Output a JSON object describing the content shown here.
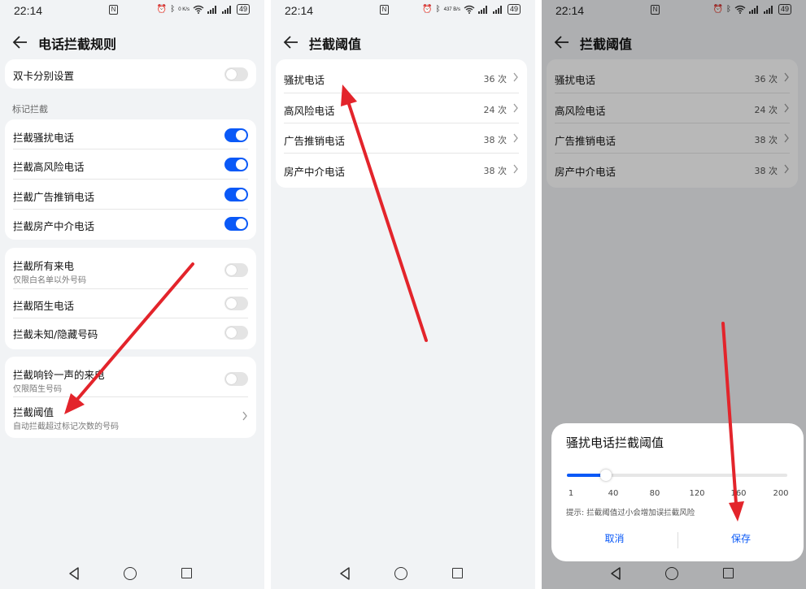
{
  "status": {
    "time": "22:14",
    "nfc": "N",
    "speed_a": "0 K/s",
    "speed_b": "437 B/s",
    "battery": "49"
  },
  "screen1": {
    "title": "电话拦截规则",
    "dual_sim": {
      "label": "双卡分别设置",
      "on": false
    },
    "section_mark": "标记拦截",
    "mark_rows": [
      {
        "label": "拦截骚扰电话",
        "on": true
      },
      {
        "label": "拦截高风险电话",
        "on": true
      },
      {
        "label": "拦截广告推销电话",
        "on": true
      },
      {
        "label": "拦截房产中介电话",
        "on": true
      }
    ],
    "block_rows": [
      {
        "label": "拦截所有来电",
        "sub": "仅限白名单以外号码",
        "on": false
      },
      {
        "label": "拦截陌生电话",
        "sub": "",
        "on": false
      },
      {
        "label": "拦截未知/隐藏号码",
        "sub": "",
        "on": false
      }
    ],
    "ring_once": {
      "label": "拦截响铃一声的来电",
      "sub": "仅限陌生号码",
      "on": false
    },
    "threshold": {
      "label": "拦截阈值",
      "sub": "自动拦截超过标记次数的号码"
    }
  },
  "screen2": {
    "title": "拦截阈值",
    "rows": [
      {
        "label": "骚扰电话",
        "value": "36 次"
      },
      {
        "label": "高风险电话",
        "value": "24 次"
      },
      {
        "label": "广告推销电话",
        "value": "38 次"
      },
      {
        "label": "房产中介电话",
        "value": "38 次"
      }
    ]
  },
  "screen3": {
    "title": "拦截阈值",
    "rows": [
      {
        "label": "骚扰电话",
        "value": "36 次"
      },
      {
        "label": "高风险电话",
        "value": "24 次"
      },
      {
        "label": "广告推销电话",
        "value": "38 次"
      },
      {
        "label": "房产中介电话",
        "value": "38 次"
      }
    ],
    "dialog": {
      "title": "骚扰电话拦截阈值",
      "slider_min": 1,
      "slider_max": 200,
      "slider_value": 36,
      "ticks": [
        "1",
        "40",
        "80",
        "120",
        "160",
        "200"
      ],
      "hint": "提示: 拦截阈值过小会增加误拦截风险",
      "cancel": "取消",
      "save": "保存"
    }
  },
  "colors": {
    "accent": "#0a59f7",
    "arrow": "#e3242b",
    "background": "#f1f3f5"
  }
}
